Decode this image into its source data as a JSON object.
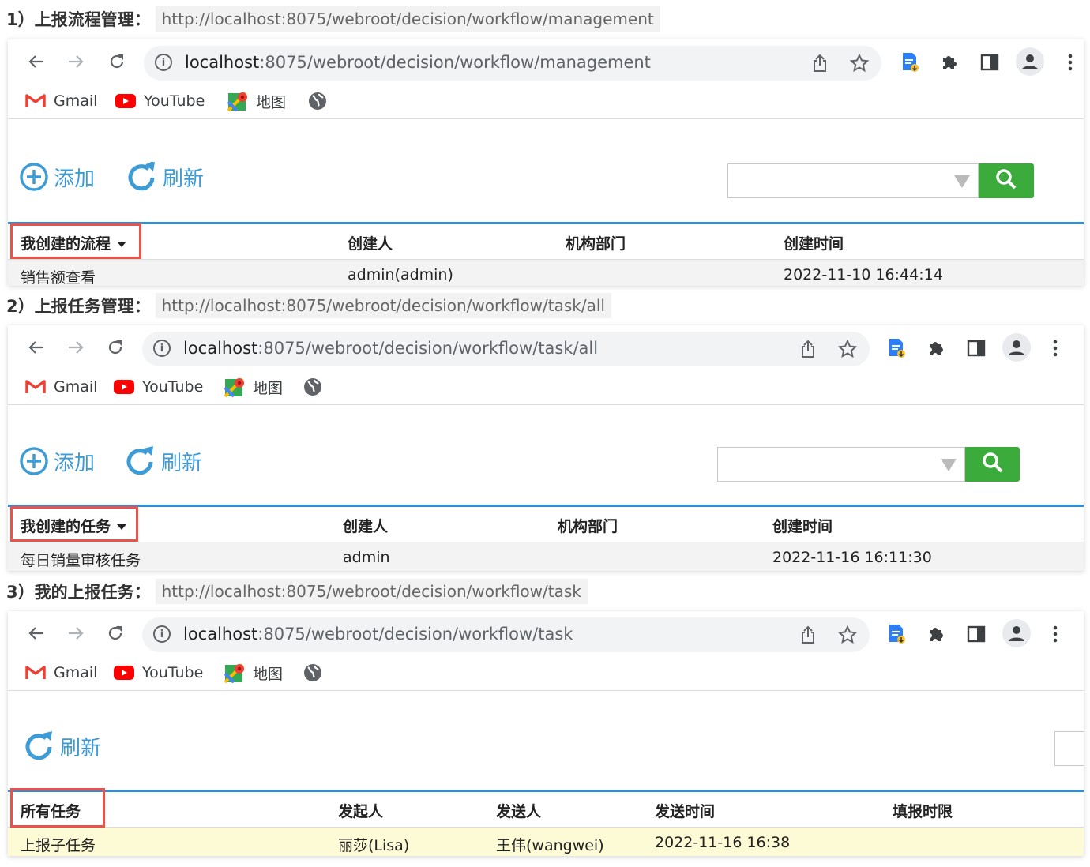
{
  "sections": [
    {
      "title": "1）上报流程管理：",
      "url_label": "http://localhost:8075/webroot/decision/workflow/management",
      "browser": {
        "address_host": "localhost",
        "address_path": ":8075/webroot/decision/workflow/management",
        "bookmarks": [
          "Gmail",
          "YouTube",
          "地图"
        ]
      },
      "actions": {
        "add": "添加",
        "refresh": "刷新"
      },
      "table": {
        "headers": [
          "我创建的流程",
          "创建人",
          "机构部门",
          "创建时间"
        ],
        "rows": [
          [
            "销售额查看",
            "admin(admin)",
            "",
            "2022-11-10 16:44:14"
          ]
        ]
      }
    },
    {
      "title": "2）上报任务管理：",
      "url_label": "http://localhost:8075/webroot/decision/workflow/task/all",
      "browser": {
        "address_host": "localhost",
        "address_path": ":8075/webroot/decision/workflow/task/all",
        "bookmarks": [
          "Gmail",
          "YouTube",
          "地图"
        ]
      },
      "actions": {
        "add": "添加",
        "refresh": "刷新"
      },
      "table": {
        "headers": [
          "我创建的任务",
          "创建人",
          "机构部门",
          "创建时间"
        ],
        "rows": [
          [
            "每日销量审核任务",
            "admin",
            "",
            "2022-11-16 16:11:30"
          ]
        ]
      }
    },
    {
      "title": "3）我的上报任务：",
      "url_label": "http://localhost:8075/webroot/decision/workflow/task",
      "browser": {
        "address_host": "localhost",
        "address_path": ":8075/webroot/decision/workflow/task",
        "bookmarks": [
          "Gmail",
          "YouTube",
          "地图"
        ]
      },
      "actions": {
        "refresh": "刷新"
      },
      "table": {
        "headers": [
          "所有任务",
          "发起人",
          "发送人",
          "发送时间",
          "填报时限"
        ],
        "rows": [
          [
            "上报子任务",
            "丽莎(Lisa)",
            "王伟(wangwei)",
            "2022-11-16 16:38",
            ""
          ]
        ]
      }
    }
  ],
  "colors": {
    "accent_blue": "#3d9bd6",
    "header_line": "#2f8ed4",
    "highlight_red": "#e8534a",
    "search_green": "#3bab3b",
    "row_yellow": "#fdfbd5"
  }
}
